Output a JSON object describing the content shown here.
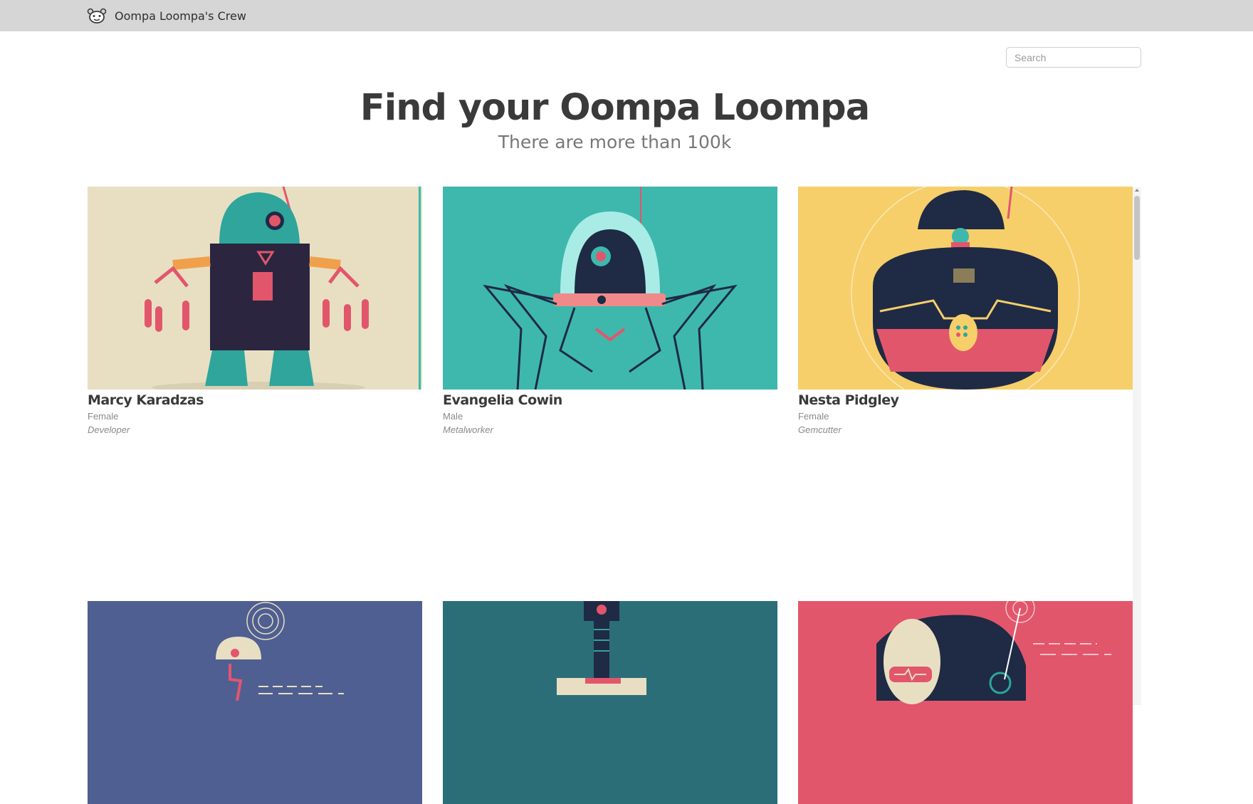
{
  "navbar": {
    "brand_icon": "oompa-face-icon",
    "brand_name": "Oompa Loompa's Crew"
  },
  "search": {
    "placeholder": "Search",
    "value": ""
  },
  "hero": {
    "title": "Find your Oompa Loompa",
    "subtitle": "There are more than 100k"
  },
  "cards": [
    {
      "name": "Marcy Karadzas",
      "gender": "Female",
      "profession": "Developer",
      "bg": "#e8dfc3"
    },
    {
      "name": "Evangelia Cowin",
      "gender": "Male",
      "profession": "Metalworker",
      "bg": "#3eb8ad"
    },
    {
      "name": "Nesta Pidgley",
      "gender": "Female",
      "profession": "Gemcutter",
      "bg": "#f6cf6b"
    },
    {
      "name": "",
      "gender": "",
      "profession": "",
      "bg": "#4f5f92"
    },
    {
      "name": "",
      "gender": "",
      "profession": "",
      "bg": "#2b6e78"
    },
    {
      "name": "",
      "gender": "",
      "profession": "",
      "bg": "#e2566c"
    }
  ],
  "colors": {
    "topbar": "#d6d6d6",
    "teal": "#2fa59c",
    "dark_navy": "#1f2a44",
    "pink": "#e2566c",
    "orange": "#f0a04b"
  }
}
